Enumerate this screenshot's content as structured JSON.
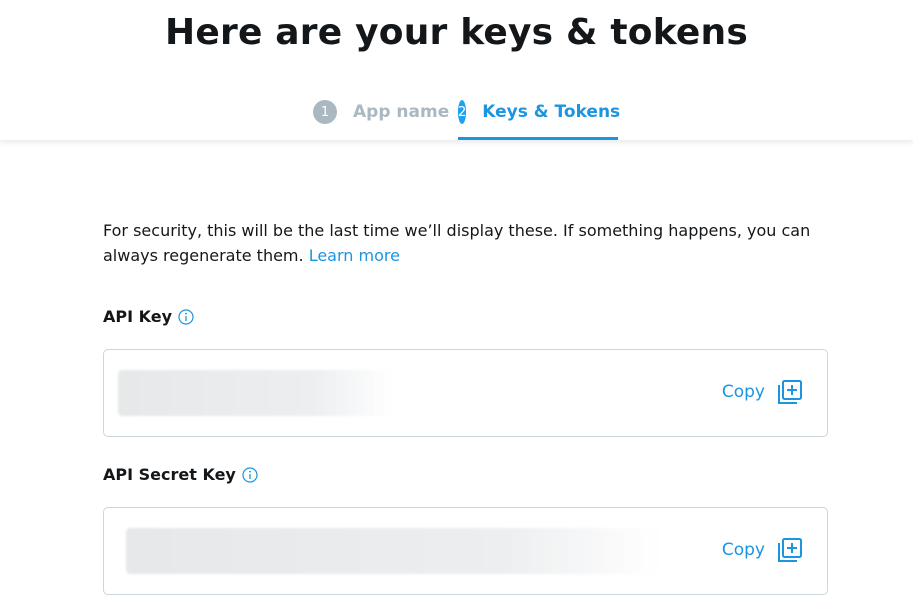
{
  "header": {
    "title": "Here are your keys & tokens"
  },
  "steps": [
    {
      "number": "1",
      "label": "App name",
      "state": "inactive"
    },
    {
      "number": "2",
      "label": "Keys & Tokens",
      "state": "active"
    }
  ],
  "intro": {
    "text": "For security, this will be the last time we’ll display these. If something happens, you can always regenerate them. ",
    "link_label": "Learn more"
  },
  "fields": [
    {
      "label": "API Key",
      "info_icon": "info-icon",
      "value": "",
      "copy_label": "Copy",
      "copy_icon": "copy-add-icon"
    },
    {
      "label": "API Secret Key",
      "info_icon": "info-icon",
      "value": "",
      "copy_label": "Copy",
      "copy_icon": "copy-add-icon"
    }
  ],
  "colors": {
    "accent": "#1b95e0",
    "inactive": "#aab8c2",
    "text": "#14171a",
    "border": "#ccd6dd"
  }
}
